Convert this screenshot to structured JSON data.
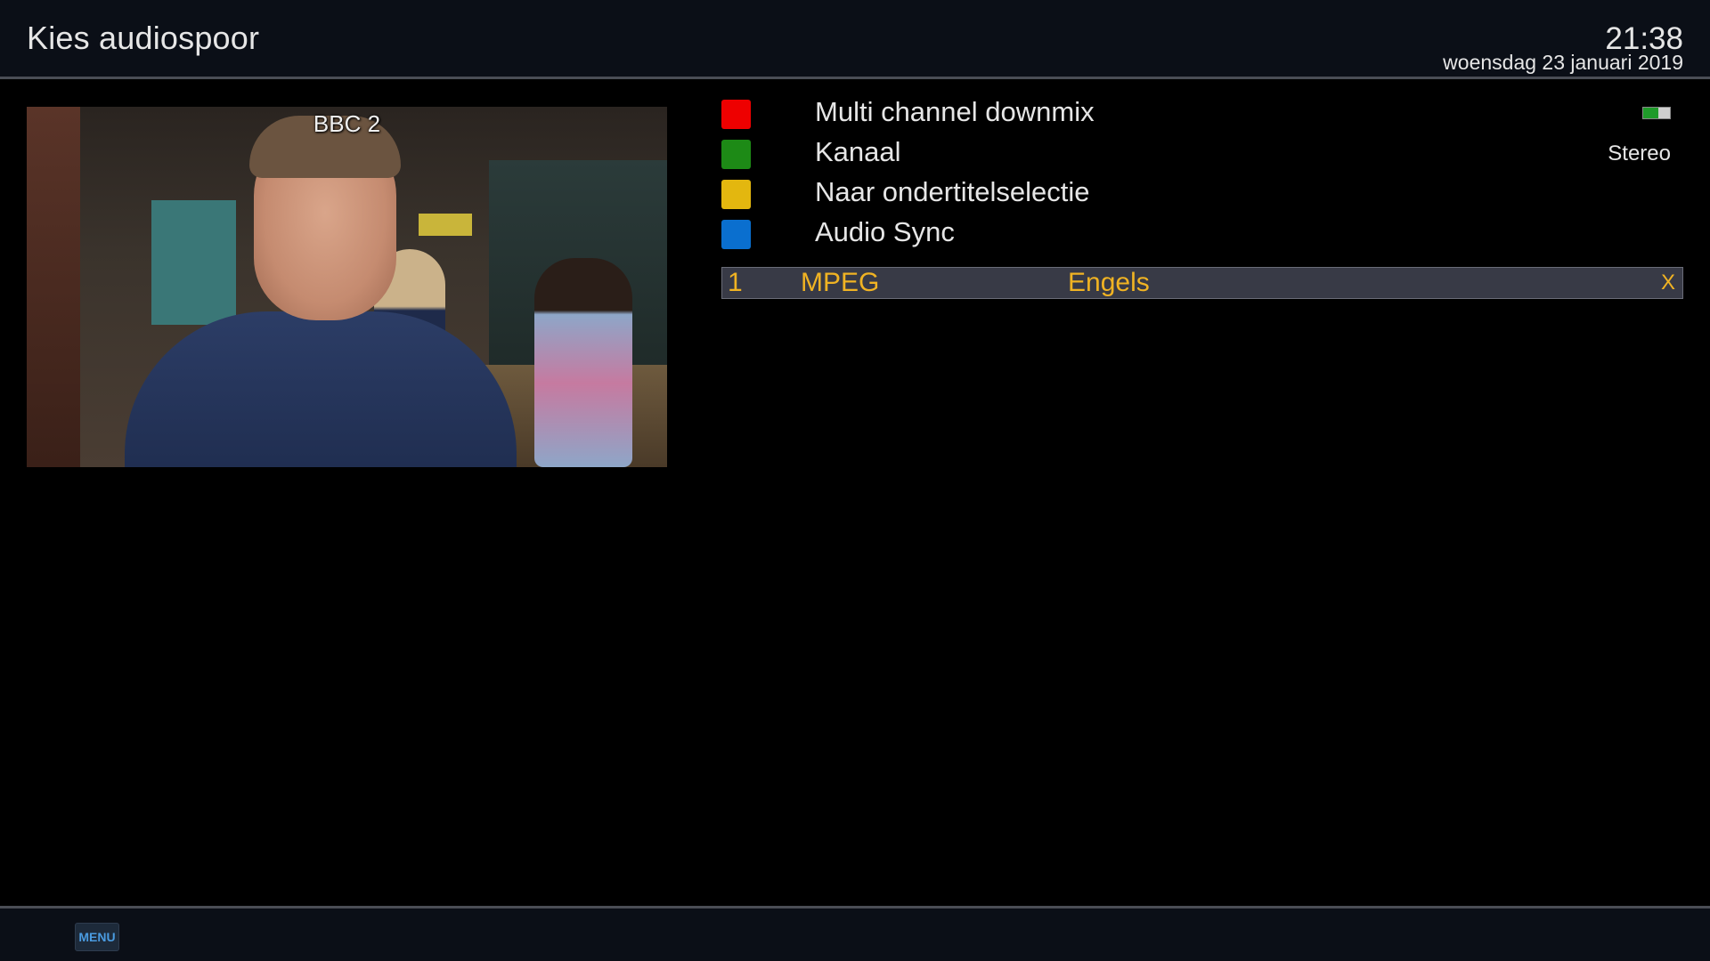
{
  "header": {
    "title": "Kies audiospoor",
    "time": "21:38",
    "date": "woensdag 23 januari 2019"
  },
  "preview": {
    "channel": "BBC 2"
  },
  "menu": {
    "items": [
      {
        "label": "Multi channel downmix",
        "key_color": "#ee0000",
        "value": "",
        "toggle_on": true
      },
      {
        "label": "Kanaal",
        "key_color": "#1d8a16",
        "value": "Stereo"
      },
      {
        "label": "Naar ondertitelselectie",
        "key_color": "#e3b70f",
        "value": ""
      },
      {
        "label": "Audio Sync",
        "key_color": "#0a6fcf",
        "value": ""
      }
    ]
  },
  "tracks": [
    {
      "number": "1",
      "codec": "MPEG",
      "language": "Engels",
      "selected_mark": "X"
    }
  ],
  "footer": {
    "menu_key": "MENU"
  },
  "colors": {
    "accent_text": "#f0b323",
    "selection_bg": "#383a46"
  }
}
